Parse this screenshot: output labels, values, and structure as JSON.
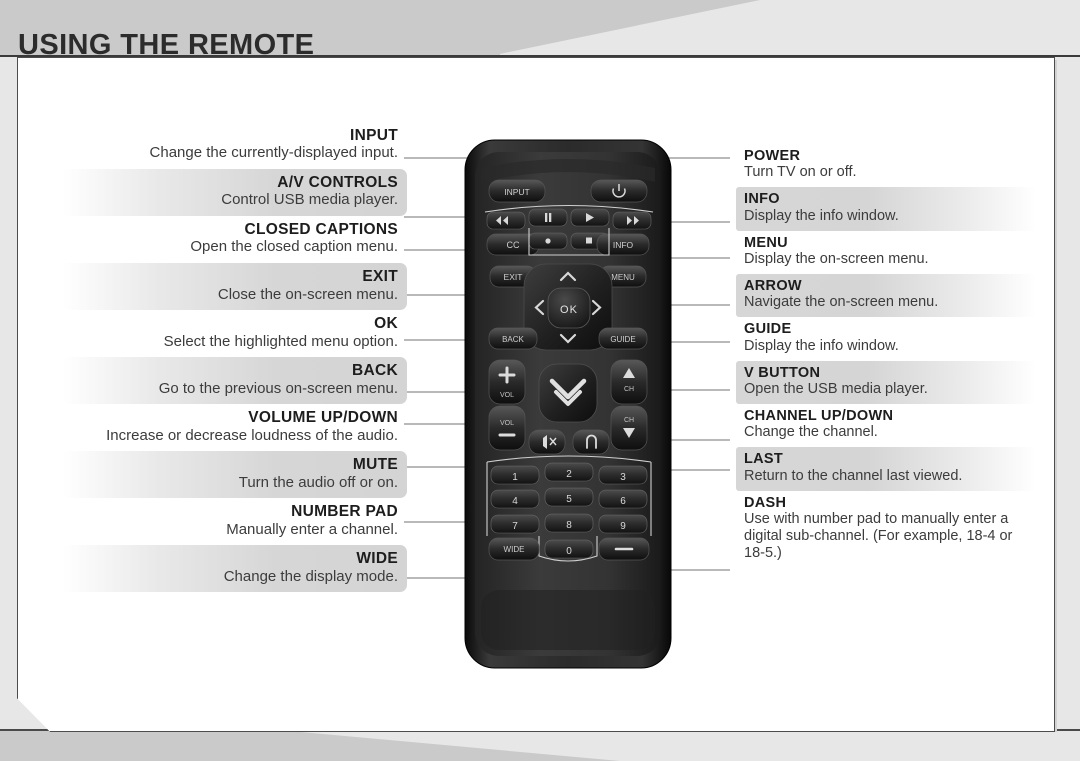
{
  "header": {
    "title": "USING THE REMOTE"
  },
  "left_column": [
    {
      "title": "INPUT",
      "desc": "Change the currently-displayed input.",
      "highlight": false
    },
    {
      "title": "A/V CONTROLS",
      "desc": "Control USB media player.",
      "highlight": true
    },
    {
      "title": "CLOSED CAPTIONS",
      "desc": "Open the closed caption menu.",
      "highlight": false
    },
    {
      "title": "EXIT",
      "desc": "Close the on-screen menu.",
      "highlight": true
    },
    {
      "title": "OK",
      "desc": "Select the highlighted menu option.",
      "highlight": false
    },
    {
      "title": "BACK",
      "desc": "Go to the previous on-screen menu.",
      "highlight": true
    },
    {
      "title": "VOLUME UP/DOWN",
      "desc": "Increase or decrease loudness of the audio.",
      "highlight": false
    },
    {
      "title": "MUTE",
      "desc": "Turn the audio off or on.",
      "highlight": true
    },
    {
      "title": "NUMBER PAD",
      "desc": "Manually enter a channel.",
      "highlight": false
    },
    {
      "title": "WIDE",
      "desc": "Change the display mode.",
      "highlight": true
    }
  ],
  "right_column": [
    {
      "title": "POWER",
      "desc": "Turn TV on or off.",
      "highlight": false
    },
    {
      "title": "INFO",
      "desc": "Display the info window.",
      "highlight": true
    },
    {
      "title": "MENU",
      "desc": "Display the on-screen menu.",
      "highlight": false
    },
    {
      "title": "ARROW",
      "desc": "Navigate the on-screen menu.",
      "highlight": true
    },
    {
      "title": "GUIDE",
      "desc": "Display the info window.",
      "highlight": false
    },
    {
      "title": "V BUTTON",
      "desc": "Open the USB media player.",
      "highlight": true
    },
    {
      "title": "CHANNEL UP/DOWN",
      "desc": "Change the channel.",
      "highlight": false
    },
    {
      "title": "LAST",
      "desc": "Return to the channel last viewed.",
      "highlight": true
    },
    {
      "title": "DASH",
      "desc": "Use with number pad to manually enter a digital sub-channel. (For example, 18-4 or 18-5.)",
      "highlight": false
    }
  ],
  "remote": {
    "buttons": {
      "input": "INPUT",
      "power": "power-icon",
      "rewind": "rewind-icon",
      "pause": "pause-icon",
      "play": "play-icon",
      "fast_forward": "fast-forward-icon",
      "cc": "CC",
      "record": "record-icon",
      "stop": "stop-icon",
      "info": "INFO",
      "exit": "EXIT",
      "menu": "MENU",
      "back": "BACK",
      "guide": "GUIDE",
      "ok": "OK",
      "arrow_up": "chevron-up-icon",
      "arrow_down": "chevron-down-icon",
      "arrow_left": "chevron-left-icon",
      "arrow_right": "chevron-right-icon",
      "vol_plus": "+",
      "vol_plus_label": "VOL",
      "vol_minus": "—",
      "vol_minus_label": "VOL",
      "ch_up_label": "CH",
      "ch_down_label": "CH",
      "v_button": "v-logo-icon",
      "mute": "mute-icon",
      "last": "last-return-icon",
      "wide": "WIDE",
      "dash": "—",
      "numbers": [
        "1",
        "2",
        "3",
        "4",
        "5",
        "6",
        "7",
        "8",
        "9",
        "0"
      ]
    }
  },
  "colors": {
    "page_bg": "#e7e7e7",
    "header_band": "#cacaca",
    "card_bg": "#ffffff",
    "card_border": "#4c4c4c",
    "title_text": "#2c2c2c",
    "row_highlight": "#d6d6d6",
    "remote_body": "#1b1b1b",
    "leader_line": "#8a8a8a"
  }
}
